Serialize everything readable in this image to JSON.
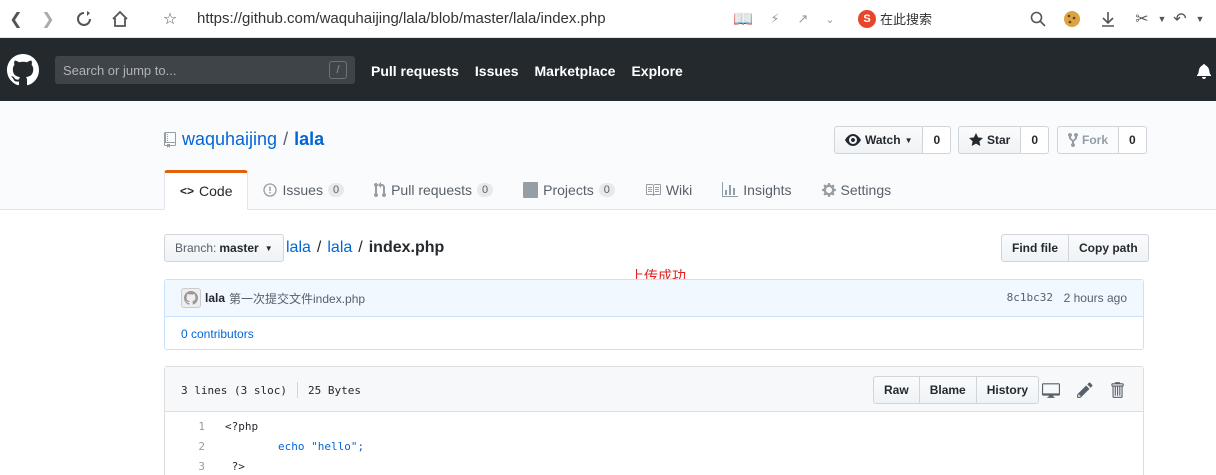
{
  "browser": {
    "url": "https://github.com/waquhaijing/lala/blob/master/lala/index.php",
    "search_placeholder": "在此搜索"
  },
  "header": {
    "search_placeholder": "Search or jump to...",
    "search_key": "/",
    "nav": [
      "Pull requests",
      "Issues",
      "Marketplace",
      "Explore"
    ]
  },
  "repo": {
    "owner": "waquhaijing",
    "name": "lala",
    "watch_label": "Watch",
    "watch_count": "0",
    "star_label": "Star",
    "star_count": "0",
    "fork_label": "Fork",
    "fork_count": "0"
  },
  "tabs": {
    "code": "Code",
    "issues": "Issues",
    "issues_count": "0",
    "pulls": "Pull requests",
    "pulls_count": "0",
    "projects": "Projects",
    "projects_count": "0",
    "wiki": "Wiki",
    "insights": "Insights",
    "settings": "Settings"
  },
  "path": {
    "branch_prefix": "Branch:",
    "branch": "master",
    "crumbs": [
      "lala",
      "lala"
    ],
    "file": "index.php",
    "find_file": "Find file",
    "copy_path": "Copy path"
  },
  "annotation": "上传成功",
  "commit": {
    "author": "lala",
    "message": "第一次提交文件index.php",
    "sha": "8c1bc32",
    "time": "2 hours ago",
    "contributors": "0 contributors"
  },
  "file": {
    "lines_info": "3 lines (3 sloc)",
    "size": "25 Bytes",
    "raw": "Raw",
    "blame": "Blame",
    "history": "History",
    "lines": [
      {
        "n": "1",
        "text": "<?php"
      },
      {
        "n": "2",
        "text": "        echo \"hello\";"
      },
      {
        "n": "3",
        "text": " ?>"
      }
    ]
  }
}
